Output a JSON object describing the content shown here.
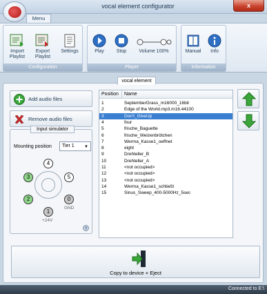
{
  "window": {
    "title": "vocal element configurator",
    "close_label": "x"
  },
  "menu": {
    "tab_label": "Menu"
  },
  "ribbon": {
    "groups": [
      {
        "label": "Configuration",
        "buttons": [
          {
            "label_line1": "Import",
            "label_line2": "Playlist",
            "icon": "import-playlist-icon"
          },
          {
            "label_line1": "Export",
            "label_line2": "Playlist",
            "icon": "export-playlist-icon"
          },
          {
            "label_line1": "Settings",
            "label_line2": "",
            "icon": "settings-icon"
          }
        ]
      },
      {
        "label": "Player",
        "buttons": [
          {
            "label_line1": "Play",
            "icon": "play-icon"
          },
          {
            "label_line1": "Stop",
            "icon": "stop-icon"
          },
          {
            "label_line1": "Volume 100%",
            "icon": "volume-slider-icon"
          }
        ]
      },
      {
        "label": "Information",
        "buttons": [
          {
            "label_line1": "Manual",
            "icon": "manual-book-icon"
          },
          {
            "label_line1": "Info",
            "icon": "info-icon"
          }
        ]
      }
    ]
  },
  "section": {
    "tab_label": "vocal element"
  },
  "actions": {
    "add_label": "Add audio files",
    "remove_label": "Remove audio files"
  },
  "simulator": {
    "title": "Input simulator",
    "mounting_label": "Mounting position",
    "mounting_value": "Tier 1",
    "dots": {
      "d4": "4",
      "d3": "3",
      "d5": "5",
      "d2": "2",
      "d0": "0",
      "d1": "1"
    },
    "gnd_label": "GND",
    "v24_label": "+24V"
  },
  "table": {
    "col_position": "Position",
    "col_name": "Name",
    "selected_index": 2,
    "rows": [
      {
        "pos": "1",
        "name": "SeptemberGrass_m16000_16bit"
      },
      {
        "pos": "2",
        "name": "Edge of the World.mp3.m16.44100"
      },
      {
        "pos": "3",
        "name": "Don't_GiveUp"
      },
      {
        "pos": "4",
        "name": "four"
      },
      {
        "pos": "5",
        "name": "frische_Baguette"
      },
      {
        "pos": "6",
        "name": "frische_Weizenbrötchen"
      },
      {
        "pos": "7",
        "name": "Werma_Kasse1_oeffnet"
      },
      {
        "pos": "8",
        "name": "eight"
      },
      {
        "pos": "9",
        "name": "Drehteller_B"
      },
      {
        "pos": "10",
        "name": "Drehteller_A"
      },
      {
        "pos": "11",
        "name": "<not occupied>"
      },
      {
        "pos": "12",
        "name": "<not occupied>"
      },
      {
        "pos": "13",
        "name": "<not occupied>"
      },
      {
        "pos": "14",
        "name": "Werma_Kasse1_schließt"
      },
      {
        "pos": "15",
        "name": "Sinus_Sweep_400-5000Hz_5sec"
      }
    ]
  },
  "copy": {
    "label": "Copy to device + Eject"
  },
  "status": {
    "text": "Connected to E:\\"
  },
  "colors": {
    "accent": "#3b7fd1",
    "green": "#3aa63a",
    "red": "#c62828",
    "status_bar": "#2f3c4a"
  }
}
